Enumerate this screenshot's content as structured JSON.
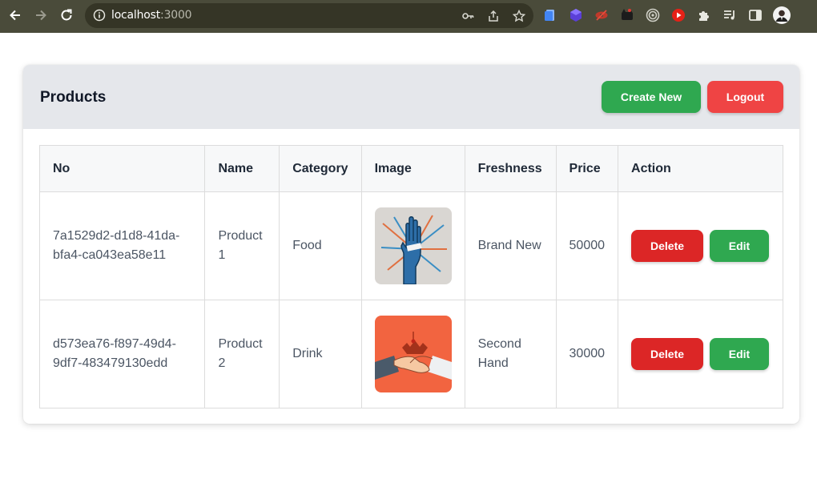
{
  "browser": {
    "url_host": "localhost",
    "url_port": ":3000"
  },
  "header": {
    "title": "Products",
    "create_label": "Create New",
    "logout_label": "Logout"
  },
  "colors": {
    "create": "#2fa850",
    "logout": "#ef4444",
    "delete": "#dc2626",
    "edit": "#2fa850",
    "header_bg": "#e5e7eb"
  },
  "table": {
    "columns": [
      "No",
      "Name",
      "Category",
      "Image",
      "Freshness",
      "Price",
      "Action"
    ],
    "rows": [
      {
        "no": "7a1529d2-d1d8-41da-bfa4-ca043ea58e11",
        "name": "Product 1",
        "category": "Food",
        "image_icon": "raised-hand-image",
        "freshness": "Brand New",
        "price": "50000",
        "delete_label": "Delete",
        "edit_label": "Edit"
      },
      {
        "no": "d573ea76-f897-49d4-9df7-483479130edd",
        "name": "Product 2",
        "category": "Drink",
        "image_icon": "handshake-image",
        "freshness": "Second Hand",
        "price": "30000",
        "delete_label": "Delete",
        "edit_label": "Edit"
      }
    ]
  }
}
